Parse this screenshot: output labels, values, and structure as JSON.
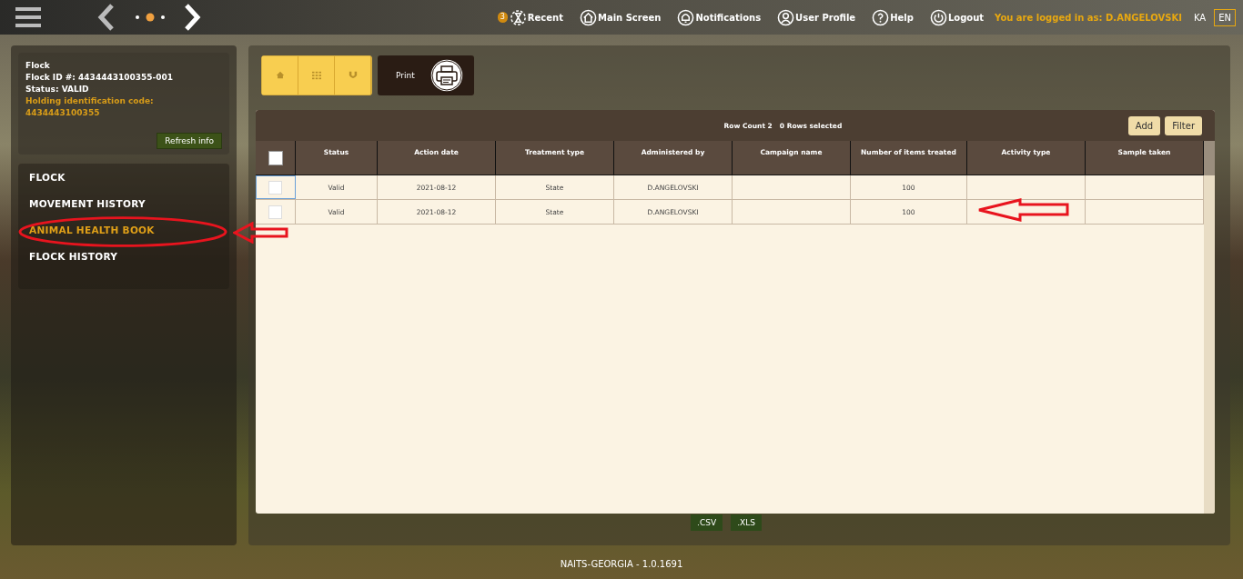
{
  "header": {
    "nav": [
      {
        "kind": "recent",
        "label": "Recent",
        "badge": "3"
      },
      {
        "kind": "home",
        "label": "Main Screen"
      },
      {
        "kind": "bell",
        "label": "Notifications"
      },
      {
        "kind": "user",
        "label": "User Profile"
      },
      {
        "kind": "help",
        "label": "Help"
      },
      {
        "kind": "power",
        "label": "Logout"
      }
    ],
    "logged_in": "You are logged in as: D.ANGELOVSKI",
    "languages": [
      {
        "label": "KA",
        "selected": false
      },
      {
        "label": "EN",
        "selected": true
      }
    ]
  },
  "info": {
    "lines": [
      "Flock",
      "Flock ID #: 4434443100355-001",
      "Status: VALID"
    ],
    "holding_label": "Holding identification code:",
    "holding_code": "4434443100355",
    "refresh": "Refresh info"
  },
  "sidebar": {
    "items": [
      {
        "label": "FLOCK",
        "selected": false
      },
      {
        "label": "MOVEMENT HISTORY",
        "selected": false
      },
      {
        "label": "ANIMAL HEALTH BOOK",
        "selected": true
      },
      {
        "label": "FLOCK HISTORY",
        "selected": false
      }
    ]
  },
  "toolbar": {
    "buttons": [
      {
        "kind": "home"
      },
      {
        "kind": "grid"
      },
      {
        "kind": "magnet"
      }
    ],
    "print": "Print"
  },
  "table": {
    "row_count": "Row Count 2",
    "selected_count": "0 Rows selected",
    "buttons": [
      "Add",
      "Filter"
    ],
    "all_checked": false,
    "columns": [
      "Status",
      "Action date",
      "Treatment type",
      "Administered by",
      "Campaign name",
      "Number of items treated",
      "Activity type",
      "Sample taken"
    ],
    "rows": [
      {
        "checked": false,
        "cells": [
          "Valid",
          "2021-08-12",
          "State",
          "D.ANGELOVSKI",
          "",
          "100",
          "",
          ""
        ]
      },
      {
        "checked": false,
        "cells": [
          "Valid",
          "2021-08-12",
          "State",
          "D.ANGELOVSKI",
          "",
          "100",
          "",
          ""
        ]
      }
    ]
  },
  "exports": [
    ".CSV",
    ".XLS"
  ],
  "footer": "NAITS-GEORGIA - 1.0.1691"
}
